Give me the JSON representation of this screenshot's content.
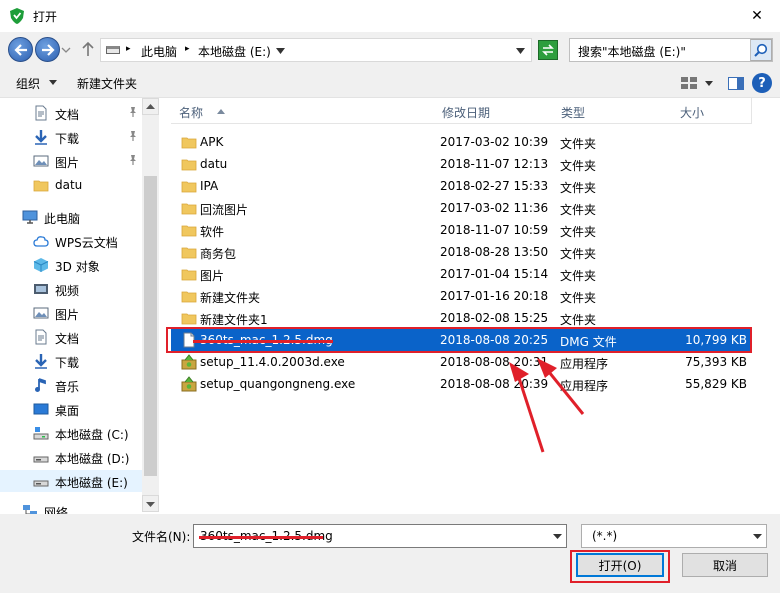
{
  "window": {
    "title": "打开",
    "close_glyph": "✕"
  },
  "address": {
    "segments": [
      "此电脑",
      "本地磁盘 (E:)"
    ],
    "separator": "▸"
  },
  "search": {
    "placeholder": "搜索\"本地磁盘 (E:)\""
  },
  "toolbar": {
    "organize": "组织",
    "new_folder": "新建文件夹"
  },
  "tree": [
    {
      "label": "文档",
      "icon": "document-icon",
      "pinned": true
    },
    {
      "label": "下载",
      "icon": "download-icon",
      "pinned": true
    },
    {
      "label": "图片",
      "icon": "pictures-icon",
      "pinned": true
    },
    {
      "label": "datu",
      "icon": "folder-icon",
      "pinned": false
    },
    {
      "label": "此电脑",
      "icon": "computer-icon",
      "pinned": false
    },
    {
      "label": "WPS云文档",
      "icon": "cloud-icon",
      "pinned": false
    },
    {
      "label": "3D 对象",
      "icon": "3d-objects-icon",
      "pinned": false
    },
    {
      "label": "视频",
      "icon": "video-icon",
      "pinned": false
    },
    {
      "label": "图片",
      "icon": "pictures-icon",
      "pinned": false
    },
    {
      "label": "文档",
      "icon": "document-icon",
      "pinned": false
    },
    {
      "label": "下载",
      "icon": "download-icon",
      "pinned": false
    },
    {
      "label": "音乐",
      "icon": "music-icon",
      "pinned": false
    },
    {
      "label": "桌面",
      "icon": "desktop-icon",
      "pinned": false
    },
    {
      "label": "本地磁盘 (C:)",
      "icon": "drive-c-icon",
      "pinned": false
    },
    {
      "label": "本地磁盘 (D:)",
      "icon": "drive-icon",
      "pinned": false
    },
    {
      "label": "本地磁盘 (E:)",
      "icon": "drive-icon",
      "pinned": false,
      "selected": true
    },
    {
      "label": "网络",
      "icon": "network-icon",
      "pinned": false
    }
  ],
  "columns": {
    "name": "名称",
    "modified": "修改日期",
    "type": "类型",
    "size": "大小"
  },
  "files": [
    {
      "name": "APK",
      "modified": "2017-03-02 10:39",
      "type": "文件夹",
      "size": "",
      "icon": "folder-icon"
    },
    {
      "name": "datu",
      "modified": "2018-11-07 12:13",
      "type": "文件夹",
      "size": "",
      "icon": "folder-icon"
    },
    {
      "name": "IPA",
      "modified": "2018-02-27 15:33",
      "type": "文件夹",
      "size": "",
      "icon": "folder-icon"
    },
    {
      "name": "回流图片",
      "modified": "2017-03-02 11:36",
      "type": "文件夹",
      "size": "",
      "icon": "folder-icon"
    },
    {
      "name": "软件",
      "modified": "2018-11-07 10:59",
      "type": "文件夹",
      "size": "",
      "icon": "folder-icon"
    },
    {
      "name": "商务包",
      "modified": "2018-08-28 13:50",
      "type": "文件夹",
      "size": "",
      "icon": "folder-icon"
    },
    {
      "name": "图片",
      "modified": "2017-01-04 15:14",
      "type": "文件夹",
      "size": "",
      "icon": "folder-icon"
    },
    {
      "name": "新建文件夹",
      "modified": "2017-01-16 20:18",
      "type": "文件夹",
      "size": "",
      "icon": "folder-icon"
    },
    {
      "name": "新建文件夹1",
      "modified": "2018-02-08 15:25",
      "type": "文件夹",
      "size": "",
      "icon": "folder-icon"
    },
    {
      "name": "360ts_mac_1.2.5.dmg",
      "modified": "2018-08-08 20:25",
      "type": "DMG 文件",
      "size": "10,799 KB",
      "icon": "file-icon",
      "selected": true
    },
    {
      "name": "setup_11.4.0.2003d.exe",
      "modified": "2018-08-08 20:31",
      "type": "应用程序",
      "size": "75,393 KB",
      "icon": "installer-icon"
    },
    {
      "name": "setup_quangongneng.exe",
      "modified": "2018-08-08 20:39",
      "type": "应用程序",
      "size": "55,829 KB",
      "icon": "installer-icon"
    }
  ],
  "footer": {
    "filename_label": "文件名(N):",
    "filename_value": "360ts_mac_1.2.5.dmg",
    "filter_value": "(*.*)",
    "open_label": "打开(O)",
    "cancel_label": "取消"
  },
  "colors": {
    "selection": "#0a63c9",
    "annotation": "#e0202a",
    "hover": "#e5f3ff"
  }
}
